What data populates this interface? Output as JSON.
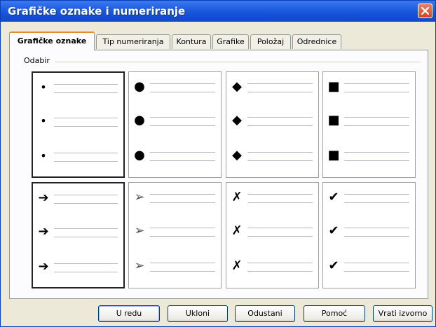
{
  "window": {
    "title": "Grafičke oznake i numeriranje"
  },
  "tabs": [
    {
      "label": "Grafičke oznake",
      "active": true
    },
    {
      "label": "Tip numeriranja",
      "active": false
    },
    {
      "label": "Kontura",
      "active": false
    },
    {
      "label": "Grafike",
      "active": false
    },
    {
      "label": "Položaj",
      "active": false
    },
    {
      "label": "Odrednice",
      "active": false
    }
  ],
  "group": {
    "label": "Odabir"
  },
  "bullets": [
    {
      "icon": "small-dot-icon",
      "glyph": "•",
      "selected": true
    },
    {
      "icon": "large-dot-icon",
      "glyph": "●",
      "selected": false
    },
    {
      "icon": "diamond-icon",
      "glyph": "◆",
      "selected": false
    },
    {
      "icon": "square-icon",
      "glyph": "■",
      "selected": false
    },
    {
      "icon": "bold-arrow-icon",
      "glyph": "➔",
      "selected": true
    },
    {
      "icon": "arrowhead-icon",
      "glyph": "➢",
      "selected": false
    },
    {
      "icon": "x-mark-icon",
      "glyph": "✗",
      "selected": false
    },
    {
      "icon": "check-mark-icon",
      "glyph": "✔",
      "selected": false
    }
  ],
  "buttons": {
    "ok": "U redu",
    "remove": "Ukloni",
    "cancel": "Odustani",
    "help": "Pomoć",
    "reset": "Vrati izvorno"
  }
}
